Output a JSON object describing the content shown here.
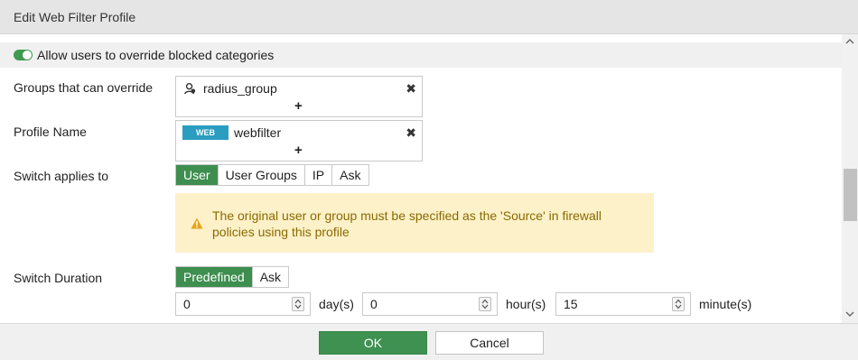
{
  "dialog": {
    "title": "Edit Web Filter Profile"
  },
  "override": {
    "toggle_label": "Allow users to override blocked categories",
    "toggle_on": true
  },
  "groups": {
    "label": "Groups that can override",
    "entry": "radius_group",
    "add_symbol": "+",
    "remove_symbol": "✖"
  },
  "profile": {
    "label": "Profile Name",
    "badge": "WEB",
    "entry": "webfilter",
    "add_symbol": "+",
    "remove_symbol": "✖"
  },
  "switch_applies": {
    "label": "Switch applies to",
    "options": [
      "User",
      "User Groups",
      "IP",
      "Ask"
    ],
    "selected": "User"
  },
  "warning": {
    "icon": "warning-triangle-icon",
    "text": "The original user or group must be specified as the 'Source' in firewall policies using this profile"
  },
  "switch_duration": {
    "label": "Switch Duration",
    "options": [
      "Predefined",
      "Ask"
    ],
    "selected": "Predefined",
    "days": "0",
    "days_unit": "day(s)",
    "hours": "0",
    "hours_unit": "hour(s)",
    "minutes": "15",
    "minutes_unit": "minute(s)"
  },
  "footer": {
    "ok_label": "OK",
    "cancel_label": "Cancel"
  },
  "colors": {
    "accent_green": "#3d8e4f",
    "badge_blue": "#2a9dc0",
    "warning_bg": "#fdf1c9",
    "warning_text": "#8a6a00"
  }
}
